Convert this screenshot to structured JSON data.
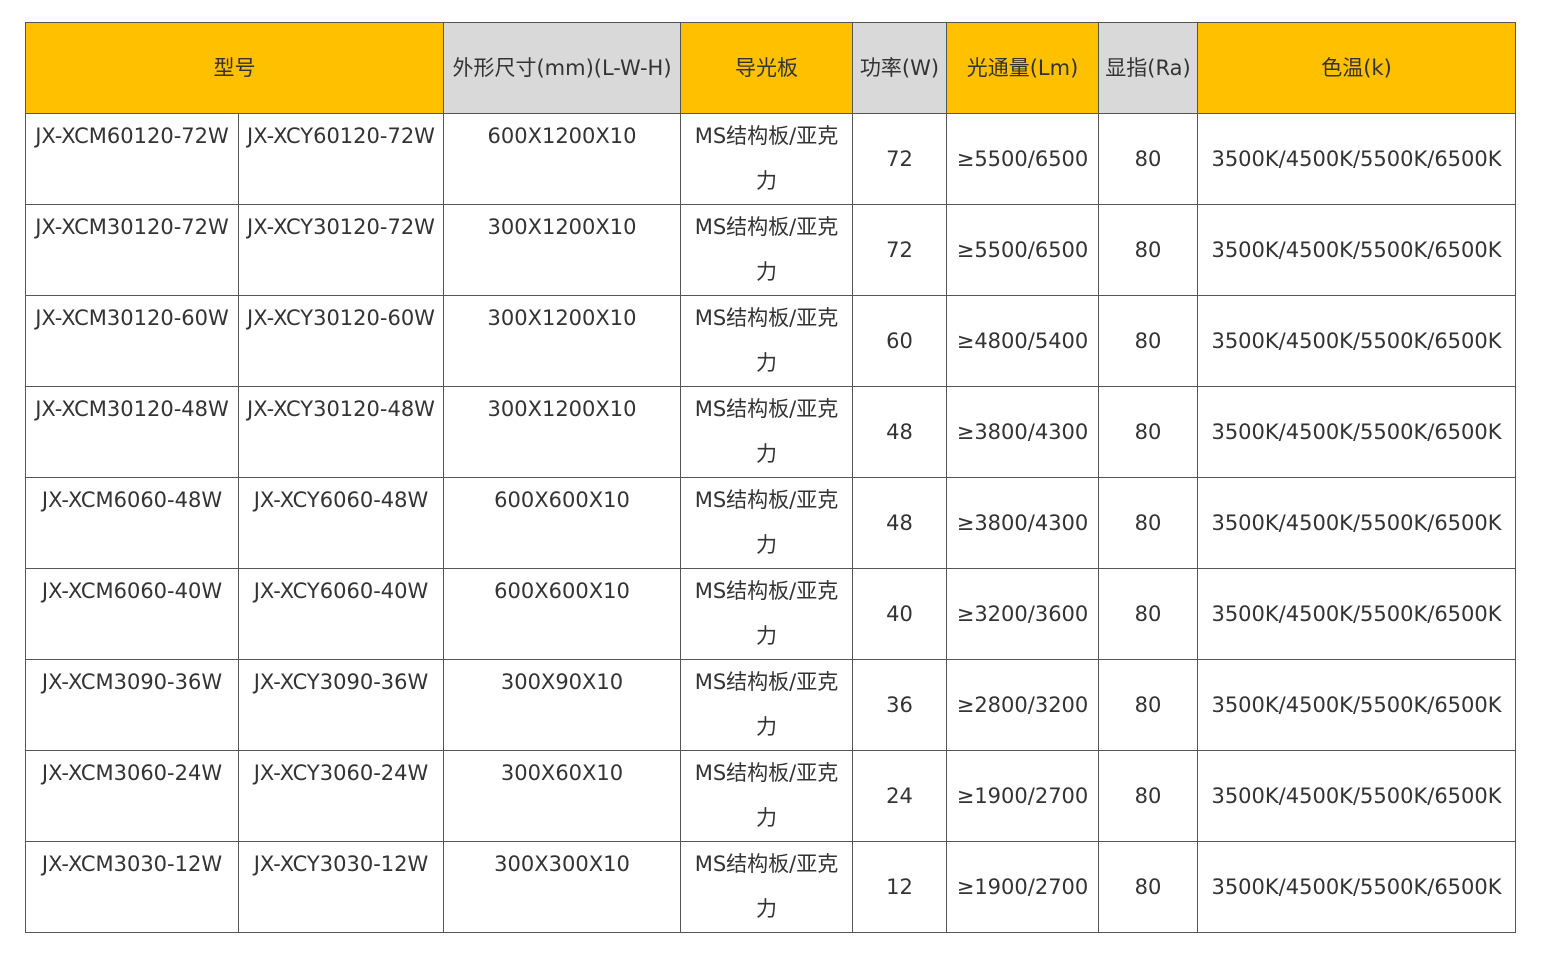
{
  "header": {
    "model": "型号",
    "dimensions": "外形尺寸(mm)(L-W-H)",
    "light_guide": "导光板",
    "power": "功率(W)",
    "luminous_flux": "光通量(Lm)",
    "cri": "显指(Ra)",
    "color_temp": "色温(k)"
  },
  "colors": {
    "header_yellow": "#ffc000",
    "header_gray": "#d9d9d9",
    "border": "#555555",
    "text": "#333333"
  },
  "rows": [
    {
      "model_m": "JX-XCM60120-72W",
      "model_y": "JX-XCY60120-72W",
      "dimensions": "600X1200X10",
      "light_guide": "MS结构板/亚克力",
      "power": "72",
      "luminous_flux": "≥5500/6500",
      "cri": "80",
      "color_temp": "3500K/4500K/5500K/6500K"
    },
    {
      "model_m": "JX-XCM30120-72W",
      "model_y": "JX-XCY30120-72W",
      "dimensions": "300X1200X10",
      "light_guide": "MS结构板/亚克力",
      "power": "72",
      "luminous_flux": "≥5500/6500",
      "cri": "80",
      "color_temp": "3500K/4500K/5500K/6500K"
    },
    {
      "model_m": "JX-XCM30120-60W",
      "model_y": "JX-XCY30120-60W",
      "dimensions": "300X1200X10",
      "light_guide": "MS结构板/亚克力",
      "power": "60",
      "luminous_flux": "≥4800/5400",
      "cri": "80",
      "color_temp": "3500K/4500K/5500K/6500K"
    },
    {
      "model_m": "JX-XCM30120-48W",
      "model_y": "JX-XCY30120-48W",
      "dimensions": "300X1200X10",
      "light_guide": "MS结构板/亚克力",
      "power": "48",
      "luminous_flux": "≥3800/4300",
      "cri": "80",
      "color_temp": "3500K/4500K/5500K/6500K"
    },
    {
      "model_m": "JX-XCM6060-48W",
      "model_y": "JX-XCY6060-48W",
      "dimensions": "600X600X10",
      "light_guide": "MS结构板/亚克力",
      "power": "48",
      "luminous_flux": "≥3800/4300",
      "cri": "80",
      "color_temp": "3500K/4500K/5500K/6500K"
    },
    {
      "model_m": "JX-XCM6060-40W",
      "model_y": "JX-XCY6060-40W",
      "dimensions": "600X600X10",
      "light_guide": "MS结构板/亚克力",
      "power": "40",
      "luminous_flux": "≥3200/3600",
      "cri": "80",
      "color_temp": "3500K/4500K/5500K/6500K"
    },
    {
      "model_m": "JX-XCM3090-36W",
      "model_y": "JX-XCY3090-36W",
      "dimensions": "300X90X10",
      "light_guide": "MS结构板/亚克力",
      "power": "36",
      "luminous_flux": "≥2800/3200",
      "cri": "80",
      "color_temp": "3500K/4500K/5500K/6500K"
    },
    {
      "model_m": "JX-XCM3060-24W",
      "model_y": "JX-XCY3060-24W",
      "dimensions": "300X60X10",
      "light_guide": "MS结构板/亚克力",
      "power": "24",
      "luminous_flux": "≥1900/2700",
      "cri": "80",
      "color_temp": "3500K/4500K/5500K/6500K"
    },
    {
      "model_m": "JX-XCM3030-12W",
      "model_y": "JX-XCY3030-12W",
      "dimensions": "300X300X10",
      "light_guide": "MS结构板/亚克力",
      "power": "12",
      "luminous_flux": "≥1900/2700",
      "cri": "80",
      "color_temp": "3500K/4500K/5500K/6500K"
    }
  ]
}
